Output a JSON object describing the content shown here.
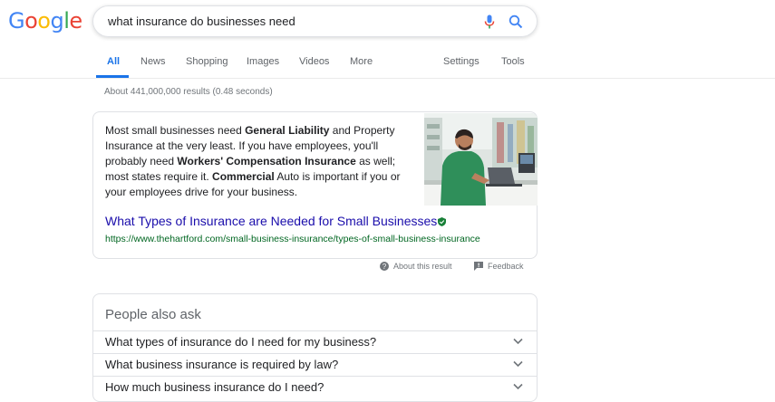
{
  "logo": {
    "letters": [
      "G",
      "o",
      "o",
      "g",
      "l",
      "e"
    ],
    "colors": [
      "#4285F4",
      "#EA4335",
      "#FBBC05",
      "#4285F4",
      "#34A853",
      "#EA4335"
    ]
  },
  "search": {
    "query": "what insurance do businesses need"
  },
  "tabs": [
    {
      "label": "All",
      "active": true
    },
    {
      "label": "News"
    },
    {
      "label": "Shopping"
    },
    {
      "label": "Images"
    },
    {
      "label": "Videos"
    },
    {
      "label": "More"
    },
    {
      "label": "Settings"
    },
    {
      "label": "Tools"
    }
  ],
  "stats": "About 441,000,000 results (0.48 seconds)",
  "featured": {
    "snippet": [
      {
        "t": "Most small businesses need "
      },
      {
        "t": "General Liability",
        "b": true
      },
      {
        "t": " and Property Insurance at the very least. If you have employees, you'll probably need "
      },
      {
        "t": "Workers' Compensation Insurance",
        "b": true
      },
      {
        "t": " as well; most states require it. "
      },
      {
        "t": "Commercial",
        "b": true
      },
      {
        "t": " Auto is important if you or your employees drive for your business."
      }
    ],
    "title": "What Types of Insurance are Needed for Small Businesses",
    "url": "https://www.thehartford.com/small-business-insurance/types-of-small-business-insurance",
    "about": "About this result",
    "feedback": "Feedback"
  },
  "paa": {
    "title": "People also ask",
    "questions": [
      "What types of insurance do I need for my business?",
      "What business insurance is required by law?",
      "How much business insurance do I need?"
    ]
  },
  "colors": {
    "link": "#1a0dab",
    "url": "#006621",
    "accent": "#1a73e8"
  }
}
